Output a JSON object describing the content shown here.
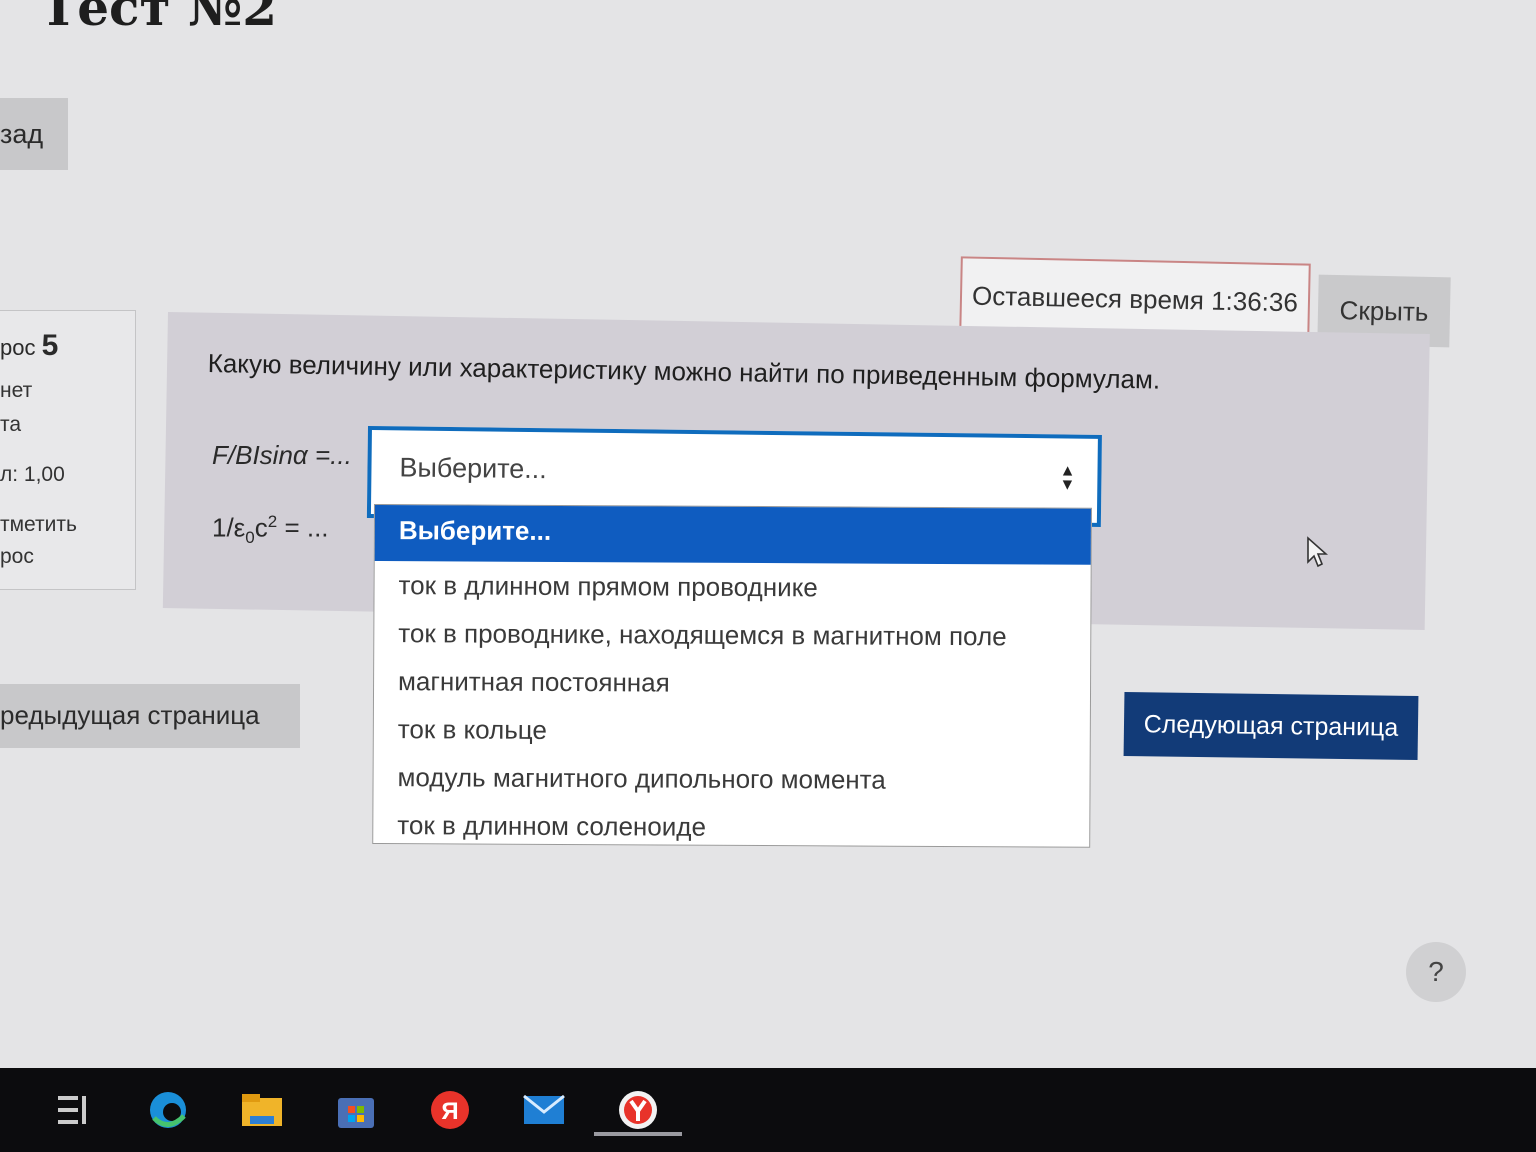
{
  "page": {
    "title": "Тест №2",
    "back_label": "зад"
  },
  "timer": {
    "label": "Оставшееся время 1:36:36",
    "hide_label": "Скрыть"
  },
  "info": {
    "question_prefix": "рос",
    "question_number": "5",
    "status_line1": "нет",
    "status_line2": "та",
    "score": "л: 1,00",
    "flag_line1": "тметить",
    "flag_line2": "рос"
  },
  "question": {
    "text": "Какую величину или характеристику можно найти по приведенным формулам.",
    "formula1": "F/BIsinα =...",
    "formula2_pre": "1/ε",
    "formula2_sub": "0",
    "formula2_c": "c",
    "formula2_sup": "2",
    "formula2_post": " = ..."
  },
  "select": {
    "value": "Выберите...",
    "options": [
      "Выберите...",
      "ток в длинном прямом проводнике",
      "ток в проводнике, находящемся в магнитном поле",
      "магнитная постоянная",
      "ток в кольце",
      "модуль магнитного дипольного момента",
      "ток в длинном соленоиде"
    ],
    "selected_index": 0
  },
  "nav": {
    "prev_label": "редыдущая страница",
    "next_label": "Следующая страница"
  },
  "help": {
    "label": "?"
  },
  "taskbar": {
    "icons": [
      "task-view-icon",
      "edge-icon",
      "file-explorer-icon",
      "store-icon",
      "yandex-icon",
      "mail-icon",
      "yandex-browser-icon"
    ]
  },
  "colors": {
    "accent": "#0f6cbd",
    "next_button": "#123b78",
    "panel": "#d2cfd6"
  }
}
